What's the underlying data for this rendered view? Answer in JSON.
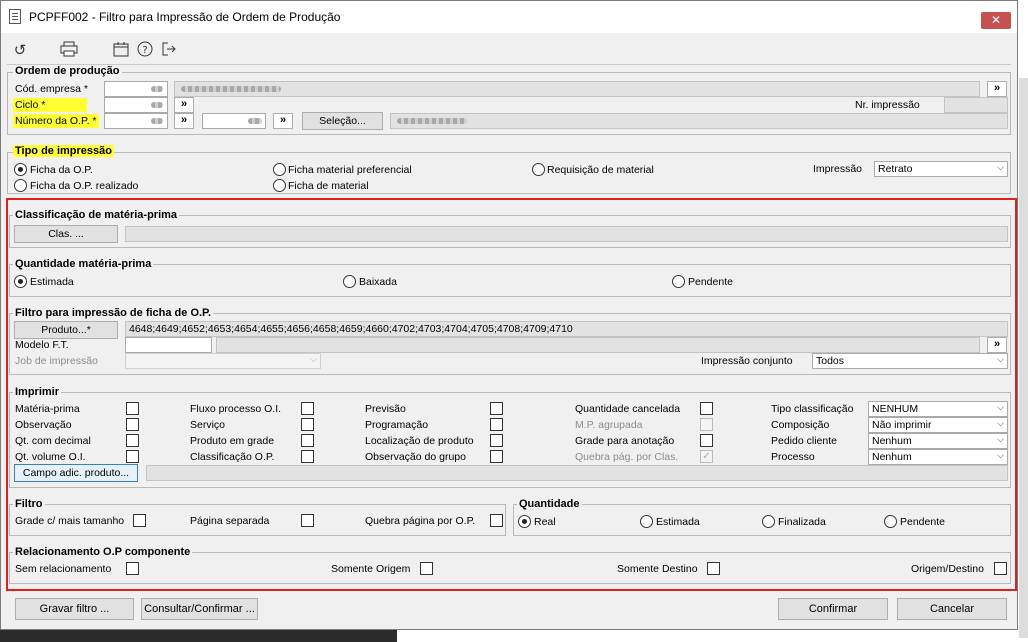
{
  "window": {
    "title": "PCPFF002 - Filtro para Impressão de Ordem de Produção",
    "close_symbol": "✕"
  },
  "toolbar": {
    "icons": [
      "undo-icon",
      "print-icon",
      "calendar-icon",
      "help-icon",
      "exit-icon"
    ]
  },
  "ordem": {
    "legend": "Ordem de produção",
    "cod_empresa_label": "Cód. empresa *",
    "ciclo_label": "Ciclo *",
    "numero_label": "Número da O.P. *",
    "nr_impressao_label": "Nr. impressão",
    "selecao_label": "Seleção..."
  },
  "tipo": {
    "legend": "Tipo de impressão",
    "ficha_op": "Ficha da O.P.",
    "ficha_op_realizado": "Ficha da O.P. realizado",
    "ficha_material_preferencial": "Ficha material preferencial",
    "ficha_material": "Ficha de material",
    "requisicao": "Requisição de material",
    "impressao_label": "Impressão",
    "impressao_value": "Retrato"
  },
  "classificacao": {
    "legend": "Classificação de matéria-prima",
    "button": "Clas. ..."
  },
  "quantidade_mp": {
    "legend": "Quantidade matéria-prima",
    "estimada": "Estimada",
    "baixada": "Baixada",
    "pendente": "Pendente"
  },
  "filtro_ficha": {
    "legend": "Filtro para impressão de ficha de O.P.",
    "produto_button": "Produto...*",
    "produto_value": "4648;4649;4652;4653;4654;4655;4656;4658;4659;4660;4702;4703;4704;4705;4708;4709;4710",
    "modelo_label": "Modelo F.T.",
    "job_label": "Job de impressão",
    "impressao_conjunto_label": "Impressão conjunto",
    "impressao_conjunto_value": "Todos"
  },
  "imprimir": {
    "legend": "Imprimir",
    "col1": [
      "Matéria-prima",
      "Observação",
      "Qt. com decimal",
      "Qt. volume O.I."
    ],
    "col2": [
      "Fluxo processo O.I.",
      "Serviço",
      "Produto em grade",
      "Classificação O.P."
    ],
    "col3": [
      "Previsão",
      "Programação",
      "Localização de produto",
      "Observação do grupo"
    ],
    "col4": [
      "Quantidade cancelada",
      "M.P. agrupada",
      "Grade para anotação",
      "Quebra pág. por Clas."
    ],
    "col5": [
      "Tipo classificação",
      "Composição",
      "Pedido cliente",
      "Processo"
    ],
    "col5_values": [
      "NENHUM",
      "Não imprimir",
      "Nenhum",
      "Nenhum"
    ],
    "campo_button": "Campo adic. produto..."
  },
  "filtro": {
    "legend": "Filtro",
    "grade": "Grade c/ mais tamanho",
    "pagina": "Página separada",
    "quebra": "Quebra página por O.P."
  },
  "quantidade": {
    "legend": "Quantidade",
    "real": "Real",
    "estimada": "Estimada",
    "finalizada": "Finalizada",
    "pendente": "Pendente"
  },
  "relacionamento": {
    "legend": "Relacionamento O.P componente",
    "sem": "Sem relacionamento",
    "origem": "Somente Origem",
    "destino": "Somente Destino",
    "origem_destino": "Origem/Destino"
  },
  "footer": {
    "gravar": "Gravar filtro ...",
    "consultar": "Consultar/Confirmar ...",
    "confirmar": "Confirmar",
    "cancelar": "Cancelar"
  },
  "glyphs": {
    "double_chevron": "»",
    "dropdown": "⌵",
    "check": "✓"
  }
}
